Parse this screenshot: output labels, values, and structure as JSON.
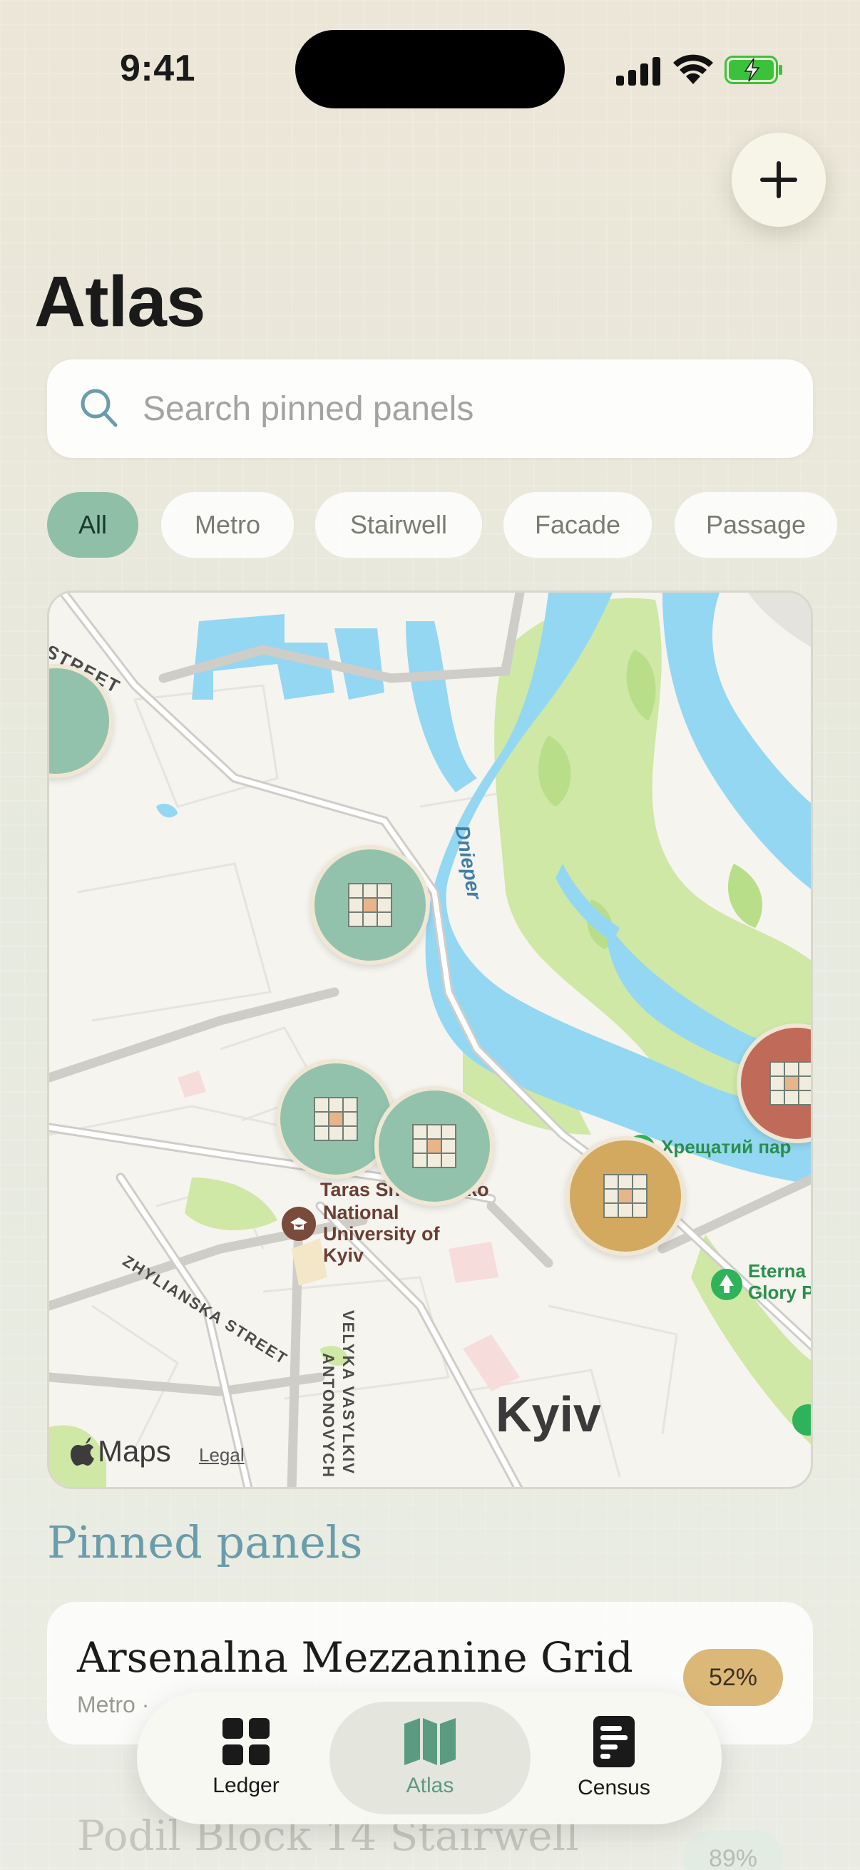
{
  "status_bar": {
    "time": "9:41"
  },
  "page": {
    "title": "Atlas"
  },
  "search": {
    "placeholder": "Search pinned panels",
    "value": ""
  },
  "filters": {
    "chips": [
      "All",
      "Metro",
      "Stairwell",
      "Facade",
      "Passage"
    ],
    "selected": "All"
  },
  "map": {
    "provider": "Maps",
    "legal": "Legal",
    "labels": {
      "street_top": "STREET",
      "river": "Dnieper",
      "university_1": "Taras Shevchenko",
      "university_2": "National",
      "university_3": "University of",
      "university_4": "Kyiv",
      "zhylianska": "ZHYLIANSKA STREET",
      "velyka": "VELYKA VASYLKIV",
      "antonovych": "ANTONOVYCH",
      "park": "Хрещатий пар",
      "eternal_1": "Eterna",
      "eternal_2": "Glory P",
      "city": "Kyiv"
    },
    "pins": [
      {
        "name": "pin-west-edge",
        "status": "green"
      },
      {
        "name": "pin-north",
        "status": "green"
      },
      {
        "name": "pin-center-left",
        "status": "green"
      },
      {
        "name": "pin-center-right",
        "status": "green"
      },
      {
        "name": "pin-gold",
        "status": "gold"
      },
      {
        "name": "pin-red",
        "status": "red"
      }
    ],
    "colors": {
      "green": "#93c2ac",
      "gold": "#d2a95f",
      "red": "#c06a5a",
      "water": "#94d7f2",
      "park": "#cfe8a6"
    }
  },
  "pinned": {
    "title": "Pinned panels",
    "items": [
      {
        "name": "Arsenalna Mezzanine Grid",
        "subtitle": "Metro ·",
        "percent": "52%"
      },
      {
        "name": "Podil Block 14 Stairwell",
        "percent": "89%"
      }
    ]
  },
  "tab_bar": {
    "items": [
      {
        "label": "Ledger",
        "icon": "grid-icon"
      },
      {
        "label": "Atlas",
        "icon": "map-icon"
      },
      {
        "label": "Census",
        "icon": "document-icon"
      }
    ],
    "selected": "Atlas",
    "accent": "#5b9b82"
  }
}
